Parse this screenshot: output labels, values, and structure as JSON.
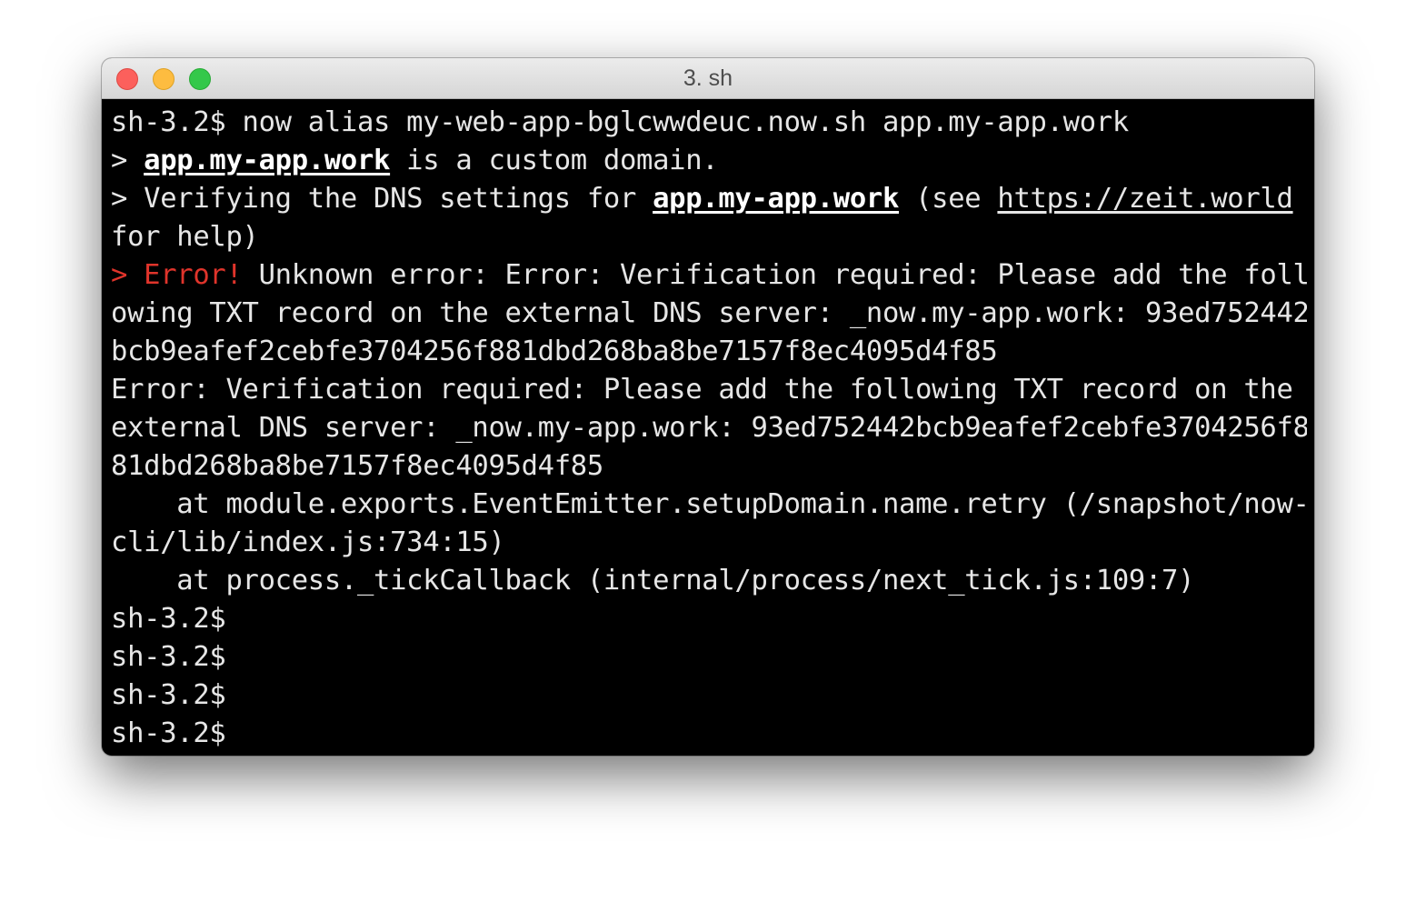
{
  "window": {
    "title": "3. sh"
  },
  "terminal": {
    "lines": [
      {
        "prompt": "sh-3.2$",
        "command": " now alias my-web-app-bglcwwdeuc.now.sh app.my-app.work"
      },
      {
        "prefix": "> ",
        "domain": "app.my-app.work",
        "rest": " is a custom domain."
      },
      {
        "prefix": "> Verifying the DNS settings for ",
        "domain": "app.my-app.work",
        "mid": " (see ",
        "link": "https://zeit.world"
      },
      {
        "text": "for help)"
      },
      {
        "error_prefix": "> ",
        "error_label": "Error!",
        "text": " Unknown error: Error: Verification required: Please add the foll"
      },
      {
        "text": "owing TXT record on the external DNS server: _now.my-app.work: 93ed752442"
      },
      {
        "text": "bcb9eafef2cebfe3704256f881dbd268ba8be7157f8ec4095d4f85"
      },
      {
        "text": "Error: Verification required: Please add the following TXT record on the"
      },
      {
        "text": "external DNS server: _now.my-app.work: 93ed752442bcb9eafef2cebfe3704256f8"
      },
      {
        "text": "81dbd268ba8be7157f8ec4095d4f85"
      },
      {
        "text": "    at module.exports.EventEmitter.setupDomain.name.retry (/snapshot/now-"
      },
      {
        "text": "cli/lib/index.js:734:15)"
      },
      {
        "text": "    at process._tickCallback (internal/process/next_tick.js:109:7)"
      },
      {
        "prompt": "sh-3.2$"
      },
      {
        "prompt": "sh-3.2$"
      },
      {
        "prompt": "sh-3.2$"
      },
      {
        "prompt": "sh-3.2$"
      }
    ]
  },
  "colors": {
    "background": "#000000",
    "foreground": "#e6e6e6",
    "error": "#e0342b",
    "close": "#fc605c",
    "minimize": "#fdbc40",
    "zoom": "#34c84a"
  }
}
